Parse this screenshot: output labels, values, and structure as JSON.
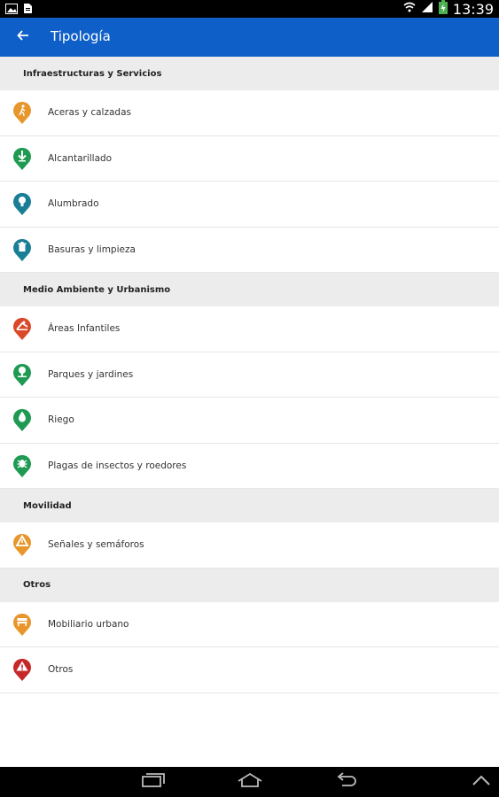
{
  "status_bar": {
    "time": "13:39",
    "icons": [
      "image-icon",
      "file-icon",
      "wifi-icon",
      "signal-icon",
      "battery-charging-icon"
    ]
  },
  "app_bar": {
    "title": "Tipología",
    "back_icon": "arrow-left-icon",
    "color": "#0f5fc8"
  },
  "sections": [
    {
      "title": "Infraestructuras y Servicios",
      "items": [
        {
          "label": "Aceras y calzadas",
          "icon": "pedestrian-icon",
          "color": "#e8962c"
        },
        {
          "label": "Alcantarillado",
          "icon": "drain-arrow-icon",
          "color": "#1e9a52"
        },
        {
          "label": "Alumbrado",
          "icon": "lightbulb-icon",
          "color": "#1a7f96"
        },
        {
          "label": "Basuras y limpieza",
          "icon": "trash-icon",
          "color": "#1a7f96"
        }
      ]
    },
    {
      "title": "Medio Ambiente y Urbanismo",
      "items": [
        {
          "label": "Áreas Infantiles",
          "icon": "playground-icon",
          "color": "#d9492a"
        },
        {
          "label": "Parques y jardines",
          "icon": "park-icon",
          "color": "#1e9a52"
        },
        {
          "label": "Riego",
          "icon": "water-drop-icon",
          "color": "#1e9a52"
        },
        {
          "label": "Plagas de insectos y roedores",
          "icon": "bug-icon",
          "color": "#1e9a52"
        }
      ]
    },
    {
      "title": "Movilidad",
      "items": [
        {
          "label": "Señales y semáforos",
          "icon": "traffic-sign-icon",
          "color": "#e8962c"
        }
      ]
    },
    {
      "title": "Otros",
      "items": [
        {
          "label": "Mobiliario urbano",
          "icon": "bench-icon",
          "color": "#e8962c"
        },
        {
          "label": "Otros",
          "icon": "warning-icon",
          "color": "#c62828"
        }
      ]
    }
  ],
  "nav_bar": {
    "buttons": [
      "recent-apps-icon",
      "home-icon",
      "back-icon",
      "chevron-up-icon"
    ]
  }
}
